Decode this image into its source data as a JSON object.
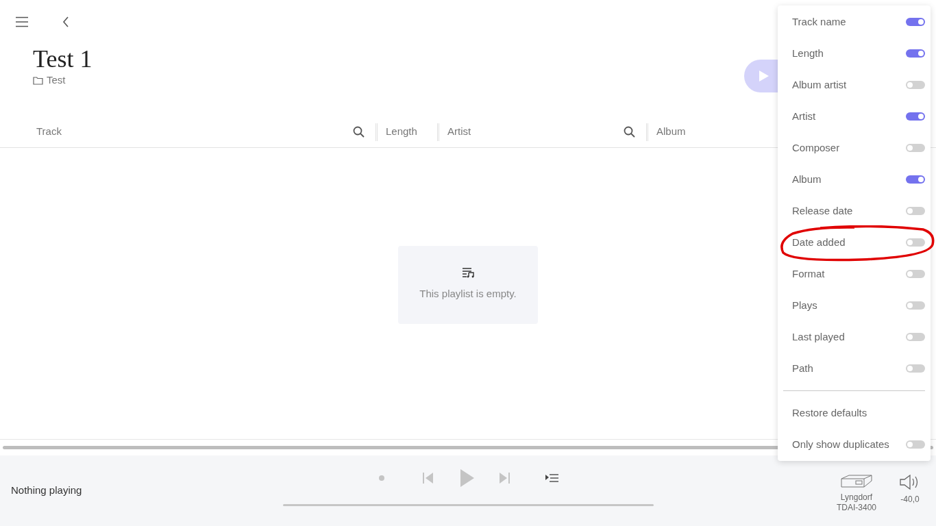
{
  "playlist": {
    "title": "Test 1",
    "folder": "Test"
  },
  "columns": [
    {
      "label": "Track",
      "searchable": true
    },
    {
      "label": "Length",
      "searchable": false
    },
    {
      "label": "Artist",
      "searchable": true
    },
    {
      "label": "Album",
      "searchable": false
    }
  ],
  "empty_state": {
    "message": "This playlist is empty."
  },
  "column_menu": {
    "items": [
      {
        "label": "Track name",
        "on": true
      },
      {
        "label": "Length",
        "on": true
      },
      {
        "label": "Album artist",
        "on": false
      },
      {
        "label": "Artist",
        "on": true
      },
      {
        "label": "Composer",
        "on": false
      },
      {
        "label": "Album",
        "on": true
      },
      {
        "label": "Release date",
        "on": false
      },
      {
        "label": "Date added",
        "on": false
      },
      {
        "label": "Format",
        "on": false
      },
      {
        "label": "Plays",
        "on": false
      },
      {
        "label": "Last played",
        "on": false
      },
      {
        "label": "Path",
        "on": false
      }
    ],
    "restore_defaults": "Restore defaults",
    "only_show_duplicates": {
      "label": "Only show duplicates",
      "on": false
    }
  },
  "player": {
    "now_playing": "Nothing playing",
    "device": "Lyngdorf TDAI-3400",
    "volume": "-40,0"
  }
}
